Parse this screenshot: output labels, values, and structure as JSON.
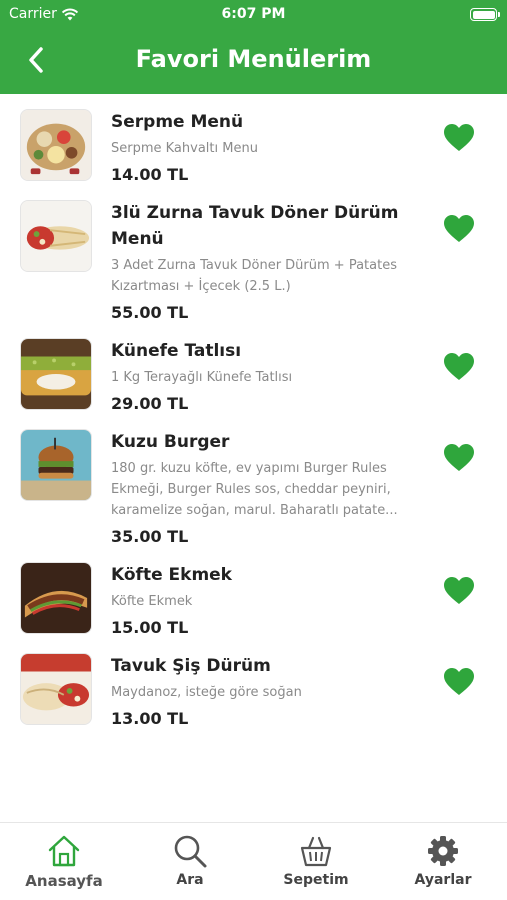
{
  "status_bar": {
    "carrier": "Carrier",
    "time": "6:07 PM"
  },
  "header": {
    "title": "Favori Menülerim"
  },
  "favorites": [
    {
      "name": "Serpme Menü",
      "description": "Serpme Kahvaltı Menu",
      "price": "14.00 TL"
    },
    {
      "name": "3lü Zurna Tavuk Döner Dürüm Menü",
      "description": "3 Adet Zurna Tavuk Döner Dürüm + Patates Kızartması + İçecek (2.5 L.)",
      "price": "55.00 TL"
    },
    {
      "name": "Künefe Tatlısı",
      "description": "1 Kg Terayağlı Künefe Tatlısı",
      "price": "29.00 TL"
    },
    {
      "name": "Kuzu Burger",
      "description": "180 gr. kuzu köfte, ev yapımı Burger Rules Ekmeği, Burger Rules sos, cheddar peyniri, karamelize soğan, marul. Baharatlı patate...",
      "price": "35.00 TL"
    },
    {
      "name": "Köfte Ekmek",
      "description": "Köfte Ekmek",
      "price": "15.00 TL"
    },
    {
      "name": "Tavuk Şiş Dürüm",
      "description": "Maydanoz, isteğe göre soğan",
      "price": "13.00 TL"
    }
  ],
  "tabs": [
    {
      "label": "Anasayfa",
      "icon": "home-icon"
    },
    {
      "label": "Ara",
      "icon": "search-icon"
    },
    {
      "label": "Sepetim",
      "icon": "basket-icon"
    },
    {
      "label": "Ayarlar",
      "icon": "gear-icon"
    }
  ],
  "colors": {
    "primary": "#38a843",
    "heart": "#2fa63c",
    "active_tab": "#2fa63c"
  }
}
